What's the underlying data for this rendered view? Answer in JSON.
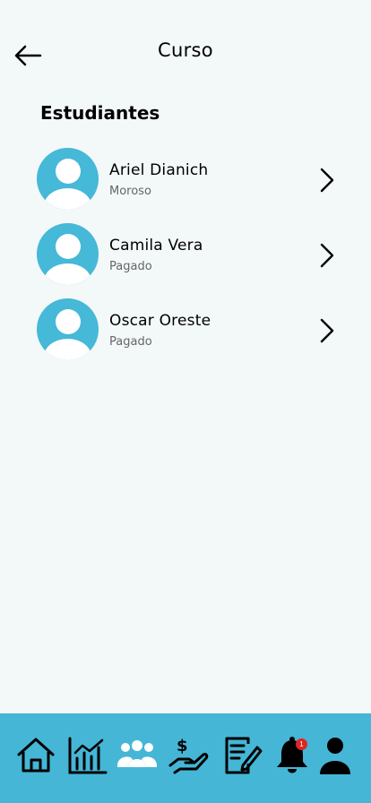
{
  "header": {
    "title": "Curso",
    "back_icon": "arrow-left-icon"
  },
  "section": {
    "title": "Estudiantes"
  },
  "students": [
    {
      "name": "Ariel Dianich",
      "status": "Moroso"
    },
    {
      "name": "Camila Vera",
      "status": "Pagado"
    },
    {
      "name": "Oscar Oreste",
      "status": "Pagado"
    }
  ],
  "bottom_nav": {
    "items": [
      {
        "icon": "home-icon"
      },
      {
        "icon": "chart-icon"
      },
      {
        "icon": "users-icon",
        "active": true
      },
      {
        "icon": "payment-icon"
      },
      {
        "icon": "notes-icon"
      },
      {
        "icon": "bell-icon",
        "badge": "1"
      },
      {
        "icon": "user-icon"
      }
    ]
  },
  "colors": {
    "background": "#f3f8f8",
    "accent": "#45b6d6",
    "avatar": "#46b8d8",
    "badge": "#e02424"
  }
}
